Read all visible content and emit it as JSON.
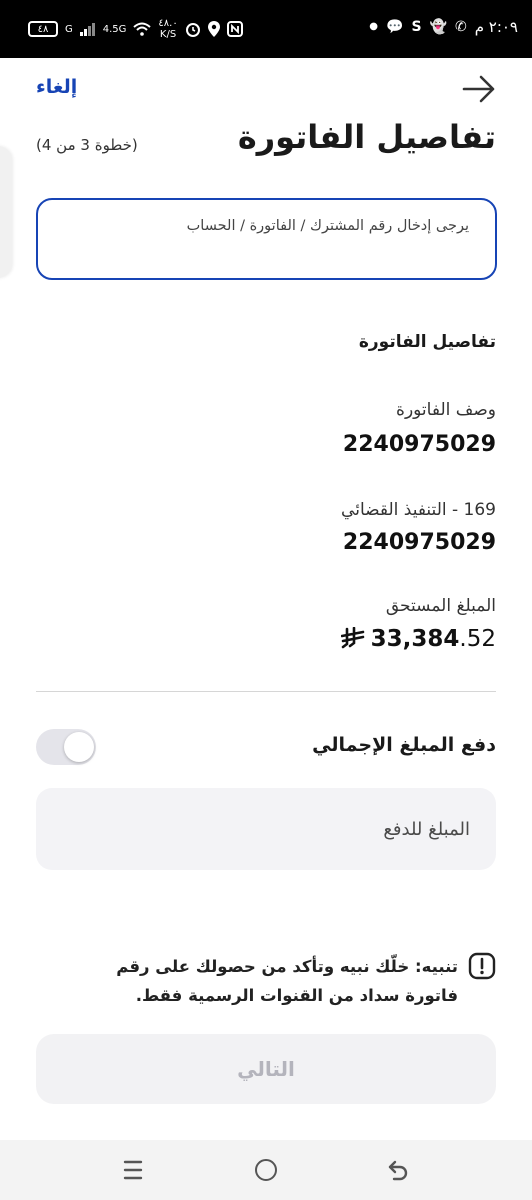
{
  "status_bar": {
    "time": "٢:٠٩ م",
    "battery": "٤٨",
    "network": "4.5G",
    "network_g": "G",
    "speed_value": "٤٨.٠",
    "speed_unit": "K/S",
    "left_icons": [
      "whatsapp-icon",
      "snapchat-icon",
      "s-app-icon",
      "chat-icon",
      "dot-icon"
    ],
    "right_icons": [
      "nfc-icon",
      "location-icon",
      "alarm-icon",
      "wifi-icon",
      "signal-icon"
    ]
  },
  "header": {
    "cancel_label": "إلغاء",
    "title": "تفاصيل الفاتورة",
    "step": "(خطوة 3 من 4)"
  },
  "breadcrumb": {
    "text": "يرجى إدخال رقم المشترك / الفاتورة / الحساب"
  },
  "details": {
    "section_title": "تفاصيل الفاتورة",
    "invoice_description_label": "وصف الفاتورة",
    "invoice_description_value": "2240975029",
    "biller_label": "169 - التنفيذ القضائي",
    "biller_value": "2240975029",
    "amount_due_label": "المبلغ المستحق",
    "amount_due_integer": "33,384",
    "amount_due_fraction": ".52",
    "currency_icon": "saudi-riyal-icon"
  },
  "payment": {
    "toggle_label": "دفع المبلغ الإجمالي",
    "toggle_on": false,
    "amount_placeholder": "المبلغ للدفع"
  },
  "warning": {
    "text": "تنبيه: خلّك نبيه وتأكد من حصولك على رقم فاتورة سداد من القنوات الرسمية فقط."
  },
  "footer": {
    "next_label": "التالي"
  },
  "nav_bar": {
    "icons": [
      "recent-apps-icon",
      "home-icon",
      "back-icon"
    ]
  },
  "colors": {
    "accent": "#1744b5",
    "disabled_text": "#b4b4bc",
    "input_bg": "#f3f3f6"
  }
}
